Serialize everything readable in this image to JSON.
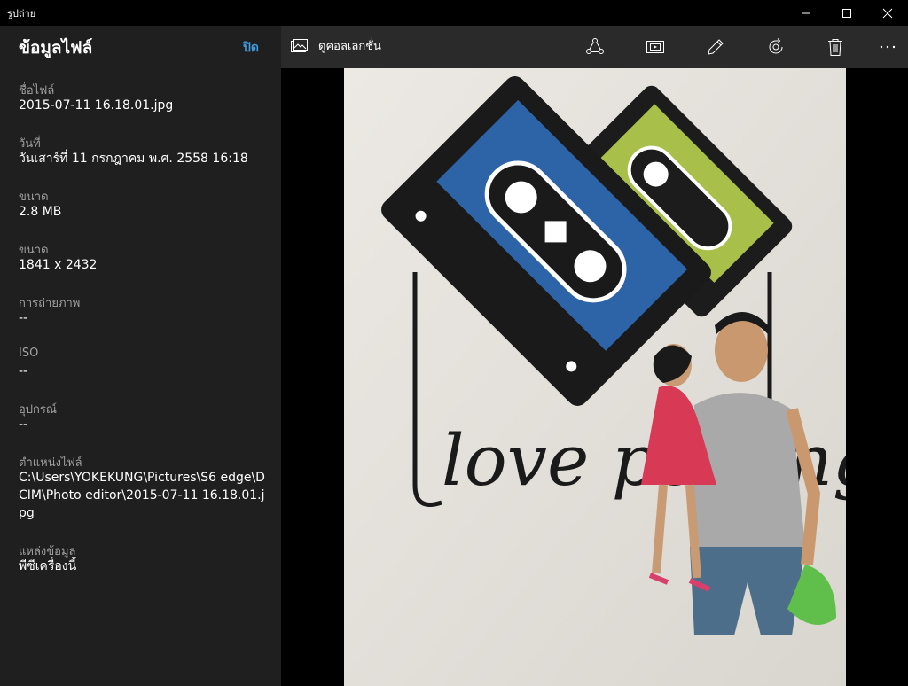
{
  "window": {
    "title": "รูปถ่าย"
  },
  "panel": {
    "title": "ข้อมูลไฟล์",
    "close_label": "ปิด",
    "fields": [
      {
        "label": "ชื่อไฟล์",
        "value": "2015-07-11 16.18.01.jpg"
      },
      {
        "label": "วันที่",
        "value": "วันเสาร์ที่ 11 กรกฎาคม พ.ศ. 2558 16:18"
      },
      {
        "label": "ขนาด",
        "value": "2.8 MB"
      },
      {
        "label": "ขนาด",
        "value": "1841 x 2432"
      },
      {
        "label": "การถ่ายภาพ",
        "value": "--"
      },
      {
        "label": "ISO",
        "value": "--"
      },
      {
        "label": "อุปกรณ์",
        "value": "--"
      },
      {
        "label": "ตำแหน่งไฟล์",
        "value": "C:\\Users\\YOKEKUNG\\Pictures\\S6 edge\\DCIM\\Photo editor\\2015-07-11 16.18.01.jpg"
      },
      {
        "label": "แหล่งข้อมูล",
        "value": "พีซีเครื่องนี้"
      }
    ]
  },
  "toolbar": {
    "collection_label": "ดูคอลเลกชั่น",
    "icons": [
      "share-icon",
      "slideshow-icon",
      "edit-icon",
      "rotate-icon",
      "delete-icon",
      "more-icon"
    ]
  },
  "photo": {
    "wall_text": "love penang"
  },
  "colors": {
    "accent": "#3f9ae0",
    "panel_bg": "#1f1f1f",
    "toolbar_bg": "#2a2a2a"
  }
}
